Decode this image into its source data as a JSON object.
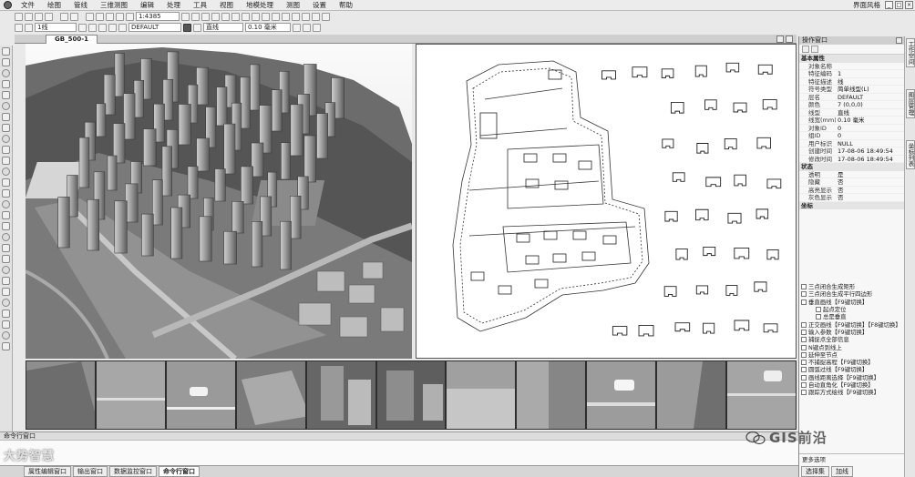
{
  "menu": [
    "文件",
    "绘图",
    "管线",
    "三维测图",
    "编辑",
    "处理",
    "工具",
    "视图",
    "地模处理",
    "测图",
    "设置",
    "帮助"
  ],
  "style_label": "界面风格",
  "toolbar1": {
    "scale": "1:4385"
  },
  "toolbar2": {
    "linetype": "1线",
    "layer": "DEFAULT",
    "line_name": "直线",
    "width": "0.10 毫米"
  },
  "doc_tab": "GB_500-1",
  "command_window_title": "命令行窗口",
  "bottom_tabs": [
    "属性编辑窗口",
    "输出窗口",
    "数据监控窗口",
    "命令行窗口"
  ],
  "watermark_left": "大势智慧",
  "watermark_right": "GIS前沿",
  "right_panel": {
    "title": "操作窗口",
    "groups": [
      {
        "name": "基本属性",
        "rows": [
          [
            "对象名称",
            ""
          ],
          [
            "特征编码",
            "1"
          ],
          [
            "特征描述",
            "线"
          ],
          [
            "符号类型",
            "简单线型(L)"
          ],
          [
            "层名",
            "DEFAULT"
          ],
          [
            "颜色",
            "7 (0,0,0)"
          ],
          [
            "线型",
            "直线"
          ],
          [
            "线宽(mm)",
            "0.10 毫米"
          ],
          [
            "对象ID",
            "0"
          ],
          [
            "组ID",
            "0"
          ],
          [
            "用户标识",
            "NULL"
          ],
          [
            "创建时间",
            "17-08-06 18:49:54"
          ],
          [
            "修改时间",
            "17-08-06 18:49:54"
          ]
        ]
      },
      {
        "name": "状态",
        "rows": [
          [
            "透明",
            "是"
          ],
          [
            "隐藏",
            "否"
          ],
          [
            "高亮显示",
            "否"
          ],
          [
            "灰色显示",
            "否"
          ]
        ]
      },
      {
        "name": "坐标",
        "rows": []
      }
    ],
    "commands": [
      "三点闭合生成矩形",
      "三点闭合生成平行四边形",
      "垂直画线【F9键切换】",
      "起点定位",
      "总是垂直",
      "正交画线【F9键切换】【F8键切换】",
      "输入参数【F9键切换】",
      "捕捉点全部信息",
      "N键点到线上",
      "延伸至节点",
      "不捕捉高程【F9键切换】",
      "圆弧过线【F9键切换】",
      "画线距离选择【F9键切换】",
      "自动直角化【F9键切换】",
      "跟踪方式绘线【F9键切换】"
    ],
    "command_pins": [
      "起点定位",
      "总是垂直"
    ],
    "bottom_left": "更多选项",
    "bottom_tabs": [
      "选项",
      "加线"
    ],
    "footer_tabs": [
      "选择集",
      "加线"
    ]
  },
  "side_tabs": [
    "工作空间",
    "图层管理",
    "坐标列表"
  ]
}
